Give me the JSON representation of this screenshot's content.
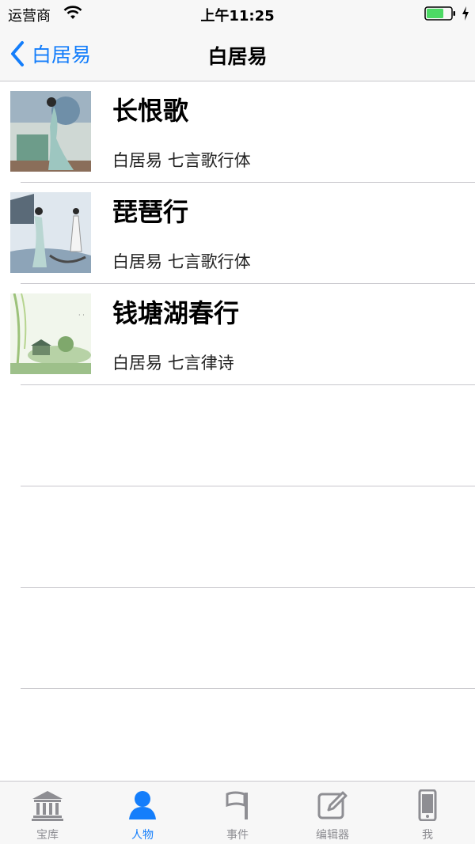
{
  "status": {
    "carrier": "运营商",
    "time": "上午11:25",
    "battery_level": 0.7
  },
  "nav": {
    "back_label": "白居易",
    "title": "白居易"
  },
  "poems": [
    {
      "title": "长恨歌",
      "subtitle": "白居易 七言歌行体"
    },
    {
      "title": "琵琶行",
      "subtitle": "白居易 七言歌行体"
    },
    {
      "title": "钱塘湖春行",
      "subtitle": "白居易 七言律诗"
    }
  ],
  "tabs": [
    {
      "label": "宝库",
      "icon": "temple-icon",
      "active": false
    },
    {
      "label": "人物",
      "icon": "person-icon",
      "active": true
    },
    {
      "label": "事件",
      "icon": "flag-icon",
      "active": false
    },
    {
      "label": "编辑器",
      "icon": "edit-icon",
      "active": false
    },
    {
      "label": "我",
      "icon": "phone-icon",
      "active": false
    }
  ],
  "colors": {
    "accent": "#147efb",
    "inactive": "#8e8e93",
    "battery": "#4cd964"
  }
}
